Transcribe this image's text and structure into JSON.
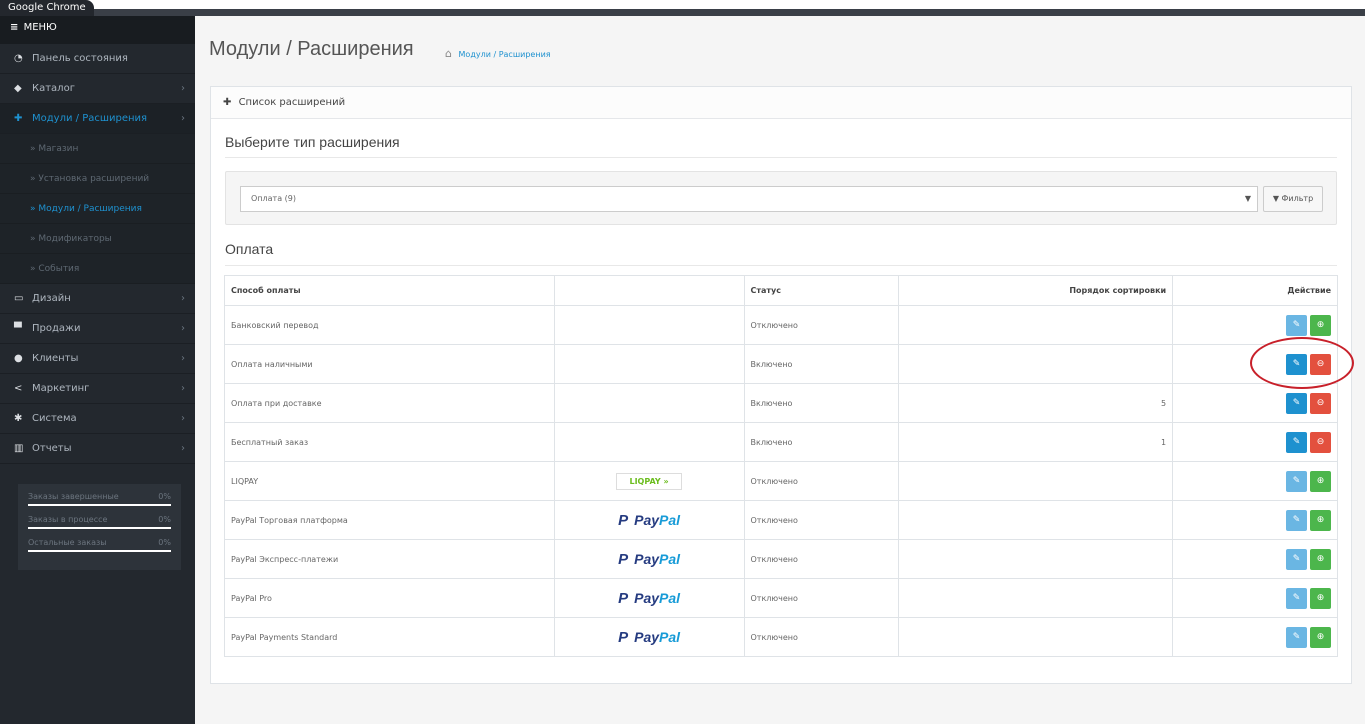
{
  "chrome": {
    "tab_title": "Google Chrome"
  },
  "sidebar": {
    "menu_label": "МЕНЮ",
    "items": [
      {
        "label": "Панель состояния",
        "icon": "dashboard-icon",
        "glyph": "◔"
      },
      {
        "label": "Каталог",
        "icon": "tag-icon",
        "glyph": "◆"
      },
      {
        "label": "Модули / Расширения",
        "icon": "puzzle-icon",
        "glyph": "✚",
        "active": true
      },
      {
        "label": "Дизайн",
        "icon": "monitor-icon",
        "glyph": "▭"
      },
      {
        "label": "Продажи",
        "icon": "cart-icon",
        "glyph": "▀"
      },
      {
        "label": "Клиенты",
        "icon": "user-icon",
        "glyph": "●"
      },
      {
        "label": "Маркетинг",
        "icon": "share-icon",
        "glyph": "<"
      },
      {
        "label": "Система",
        "icon": "gear-icon",
        "glyph": "✱"
      },
      {
        "label": "Отчеты",
        "icon": "chart-icon",
        "glyph": "▥"
      }
    ],
    "subitems": [
      {
        "label": "» Магазин"
      },
      {
        "label": "» Установка расширений"
      },
      {
        "label": "» Модули / Расширения",
        "active": true
      },
      {
        "label": "» Модификаторы"
      },
      {
        "label": "» События"
      }
    ],
    "stats": [
      {
        "label": "Заказы завершенные",
        "pct": "0%"
      },
      {
        "label": "Заказы в процессе",
        "pct": "0%"
      },
      {
        "label": "Остальные заказы",
        "pct": "0%"
      }
    ]
  },
  "header": {
    "title": "Модули / Расширения",
    "breadcrumb": "Модули / Расширения"
  },
  "panel": {
    "heading": "Список расширений",
    "choose_type": "Выберите тип расширения",
    "select_value": "Оплата (9)",
    "filter_label": "Фильтр",
    "group_title": "Оплата"
  },
  "table": {
    "headers": {
      "method": "Способ оплаты",
      "logo": "",
      "status": "Статус",
      "sort": "Порядок сортировки",
      "action": "Действие"
    },
    "rows": [
      {
        "name": "Банковский перевод",
        "logo": "",
        "status": "Отключено",
        "sort": "",
        "installed": false
      },
      {
        "name": "Оплата наличными",
        "logo": "",
        "status": "Включено",
        "sort": "",
        "installed": true
      },
      {
        "name": "Оплата при доставке",
        "logo": "",
        "status": "Включено",
        "sort": "5",
        "installed": true
      },
      {
        "name": "Бесплатный заказ",
        "logo": "",
        "status": "Включено",
        "sort": "1",
        "installed": true
      },
      {
        "name": "LIQPAY",
        "logo": "liqpay",
        "status": "Отключено",
        "sort": "",
        "installed": false
      },
      {
        "name": "PayPal Торговая платформа",
        "logo": "paypal",
        "status": "Отключено",
        "sort": "",
        "installed": false
      },
      {
        "name": "PayPal Экспресс-платежи",
        "logo": "paypal",
        "status": "Отключено",
        "sort": "",
        "installed": false
      },
      {
        "name": "PayPal Pro",
        "logo": "paypal",
        "status": "Отключено",
        "sort": "",
        "installed": false
      },
      {
        "name": "PayPal Payments Standard",
        "logo": "paypal",
        "status": "Отключено",
        "sort": "",
        "installed": false
      }
    ],
    "logo_text": {
      "liqpay": "LIQPAY »",
      "paypal_a": "Pay",
      "paypal_b": "Pal"
    }
  },
  "colors": {
    "accent": "#1e91cf",
    "install": "#4cb64c",
    "uninstall": "#e3503e",
    "highlight": "#c8202a"
  }
}
